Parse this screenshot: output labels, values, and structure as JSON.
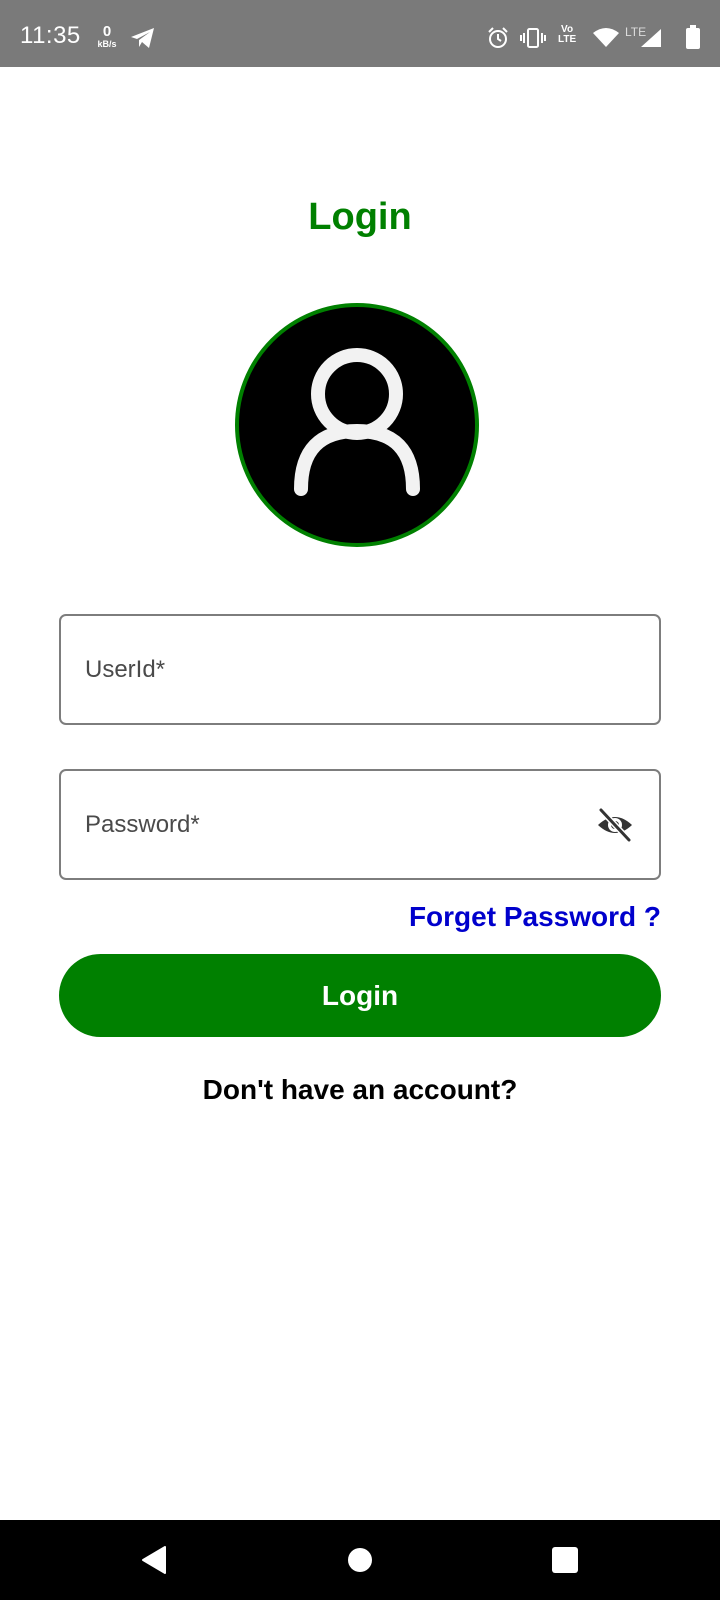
{
  "status_bar": {
    "time": "11:35",
    "net_speed_value": "0",
    "net_speed_unit": "kB/s",
    "volte_top": "Vo",
    "volte_bottom": "LTE",
    "lte_label": "LTE",
    "icons": [
      "telegram-icon",
      "alarm-icon",
      "vibrate-icon",
      "volte-icon",
      "wifi-icon",
      "signal-icon",
      "battery-icon"
    ]
  },
  "login": {
    "title": "Login",
    "avatar_icon": "user-icon",
    "userid_placeholder": "UserId*",
    "password_placeholder": "Password*",
    "password_toggle_icon": "eye-off-icon",
    "forgot_password": "Forget Password ?",
    "login_button": "Login",
    "signup_prompt": "Don't have an account?"
  },
  "nav_bar": {
    "icons": [
      "back-icon",
      "home-icon",
      "recents-icon"
    ]
  },
  "colors": {
    "status_bar": "#7a7a7a",
    "brand_green": "#008000",
    "link_blue": "#0000cc",
    "avatar_fill": "#000000",
    "nav_bar": "#000000"
  }
}
